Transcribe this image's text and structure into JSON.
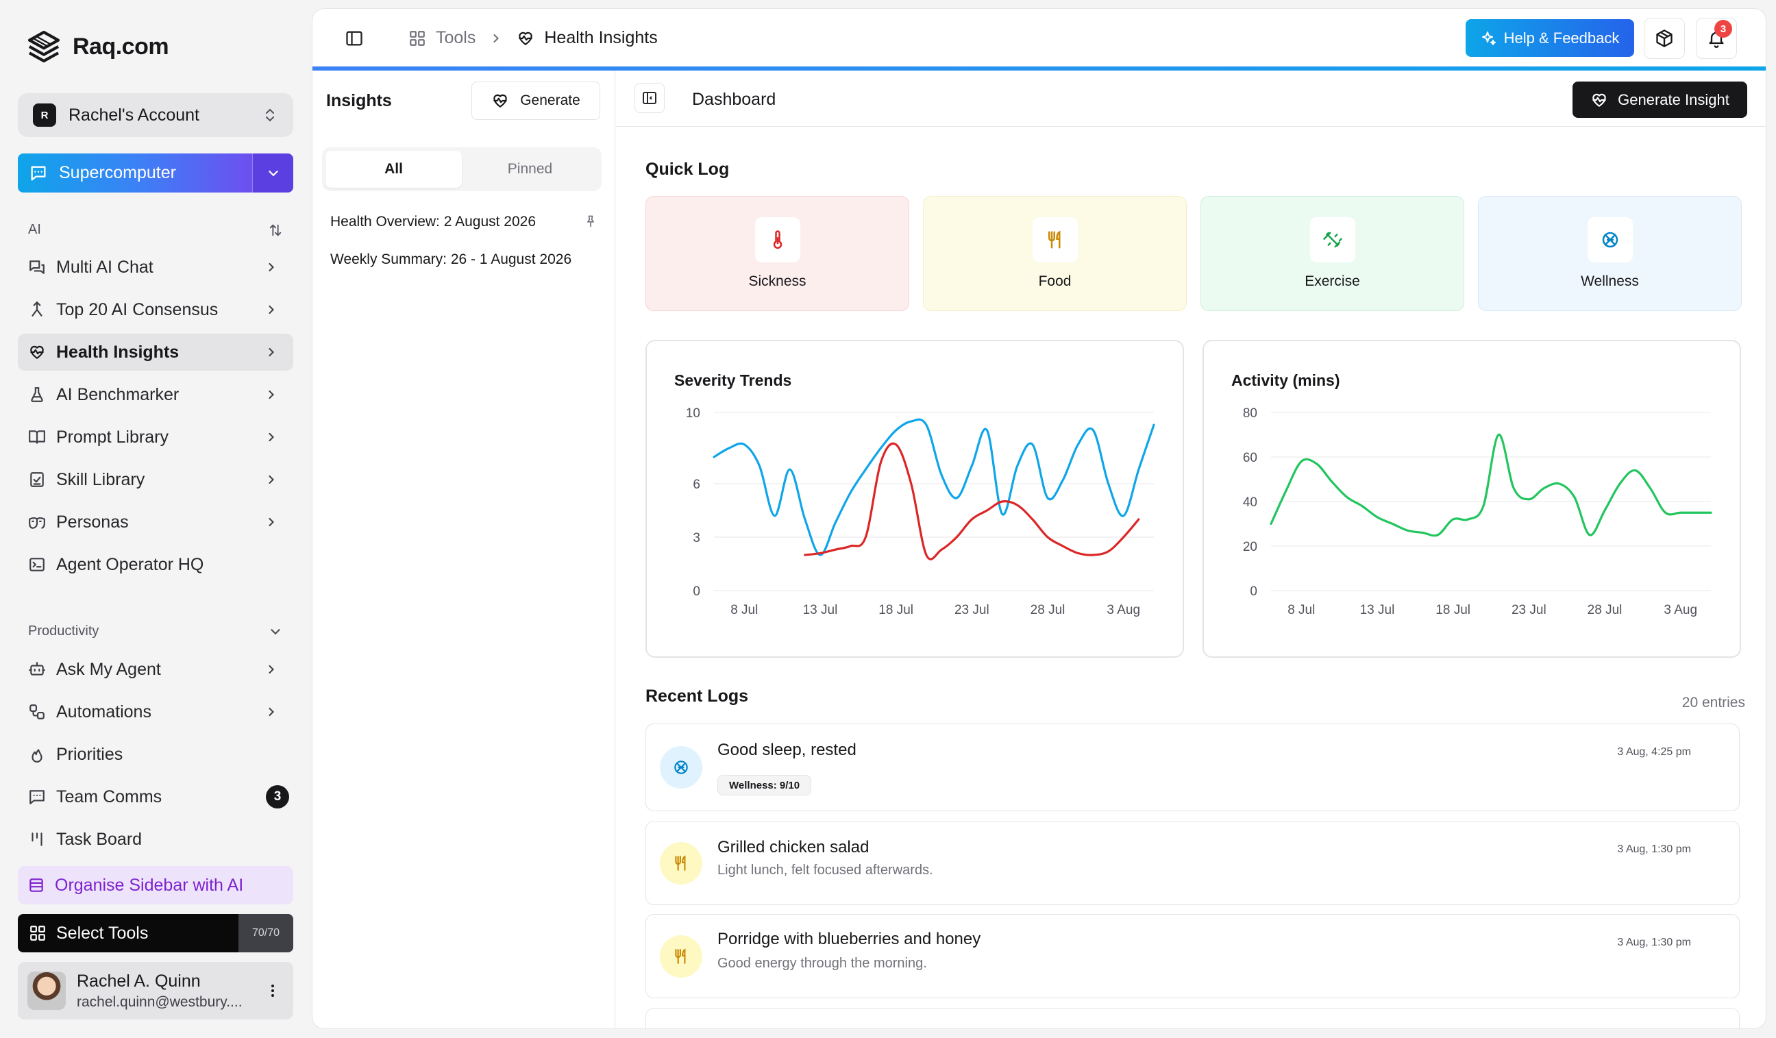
{
  "brand": {
    "name": "Raq.com"
  },
  "account": {
    "badge": "R",
    "name": "Rachel's Account"
  },
  "supercomputer": {
    "label": "Supercomputer"
  },
  "sections": {
    "ai": "AI",
    "productivity": "Productivity"
  },
  "nav_ai": [
    {
      "label": "Multi AI Chat",
      "icon": "chat-icon"
    },
    {
      "label": "Top 20 AI Consensus",
      "icon": "merge-icon"
    },
    {
      "label": "Health Insights",
      "icon": "heart-pulse-icon"
    },
    {
      "label": "AI Benchmarker",
      "icon": "flask-icon"
    },
    {
      "label": "Prompt Library",
      "icon": "book-icon"
    },
    {
      "label": "Skill Library",
      "icon": "clipboard-icon"
    },
    {
      "label": "Personas",
      "icon": "mask-icon"
    },
    {
      "label": "Agent Operator HQ",
      "icon": "terminal-icon"
    }
  ],
  "nav_productivity": [
    {
      "label": "Ask My Agent",
      "icon": "bot-icon"
    },
    {
      "label": "Automations",
      "icon": "workflow-icon"
    },
    {
      "label": "Priorities",
      "icon": "flame-icon"
    },
    {
      "label": "Team Comms",
      "icon": "message-icon",
      "badge": "3"
    },
    {
      "label": "Task Board",
      "icon": "kanban-icon"
    }
  ],
  "organise": {
    "label": "Organise Sidebar with AI"
  },
  "select_tools": {
    "label": "Select Tools",
    "count": "70/70"
  },
  "user": {
    "name": "Rachel A. Quinn",
    "email": "rachel.quinn@westbury...."
  },
  "breadcrumb": {
    "parent": "Tools",
    "current": "Health Insights"
  },
  "topbar": {
    "help_label": "Help & Feedback",
    "notification_count": "3"
  },
  "insights": {
    "title": "Insights",
    "generate_label": "Generate",
    "tabs": [
      "All",
      "Pinned"
    ],
    "items": [
      "Health Overview: 2 August 2026",
      "Weekly Summary: 26 - 1 August 2026"
    ]
  },
  "dashboard": {
    "title": "Dashboard",
    "generate_insight_label": "Generate Insight",
    "quick_log_title": "Quick Log",
    "quick_log": [
      {
        "label": "Sickness",
        "icon": "thermometer-icon",
        "bg": "#fdeeee",
        "border": "#f7d4d4",
        "color": "#dc2626"
      },
      {
        "label": "Food",
        "icon": "utensils-icon",
        "bg": "#fdfbe5",
        "border": "#f5efc4",
        "color": "#ca8a04"
      },
      {
        "label": "Exercise",
        "icon": "dumbbell-icon",
        "bg": "#ecfbf2",
        "border": "#cdeedb",
        "color": "#16a34a"
      },
      {
        "label": "Wellness",
        "icon": "brain-icon",
        "bg": "#eef7fe",
        "border": "#d6e9fa",
        "color": "#0284c7"
      }
    ],
    "recent_logs_title": "Recent Logs",
    "entries_label": "20 entries",
    "logs": [
      {
        "title": "Good sleep, rested",
        "badge": "Wellness: 9/10",
        "time": "3 Aug, 4:25 pm",
        "icon": "brain-icon"
      },
      {
        "title": "Grilled chicken salad",
        "sub": "Light lunch, felt focused afterwards.",
        "time": "3 Aug, 1:30 pm",
        "icon": "utensils-icon"
      },
      {
        "title": "Porridge with blueberries and honey",
        "sub": "Good energy through the morning.",
        "time": "3 Aug, 1:30 pm",
        "icon": "utensils-icon"
      }
    ]
  },
  "colors": {
    "sickness": "#dc2626",
    "wellness": "#0ea5e9",
    "exercise": "#22c55e",
    "accent": "#3b82f6"
  },
  "chart_data": [
    {
      "type": "line",
      "title": "Severity Trends",
      "xlabel": "",
      "ylabel": "",
      "x_ticks": [
        "8 Jul",
        "13 Jul",
        "18 Jul",
        "23 Jul",
        "28 Jul",
        "3 Aug"
      ],
      "y_ticks": [
        0,
        3,
        6,
        10
      ],
      "ylim": [
        0,
        10
      ],
      "x": [
        "6 Jul",
        "7 Jul",
        "8 Jul",
        "9 Jul",
        "10 Jul",
        "11 Jul",
        "12 Jul",
        "13 Jul",
        "14 Jul",
        "15 Jul",
        "16 Jul",
        "17 Jul",
        "18 Jul",
        "19 Jul",
        "20 Jul",
        "21 Jul",
        "22 Jul",
        "23 Jul",
        "24 Jul",
        "25 Jul",
        "26 Jul",
        "27 Jul",
        "28 Jul",
        "29 Jul",
        "30 Jul",
        "31 Jul",
        "1 Aug",
        "2 Aug",
        "3 Aug",
        "4 Aug"
      ],
      "series": [
        {
          "color": "#0ea5e9",
          "values": [
            7.5,
            8.0,
            8.2,
            7.0,
            4.2,
            6.8,
            4.0,
            2.0,
            3.8,
            5.5,
            6.8,
            8.0,
            9.0,
            9.5,
            9.3,
            6.5,
            5.2,
            7.0,
            9.0,
            4.3,
            7.0,
            8.2,
            5.2,
            6.2,
            8.2,
            9.0,
            6.0,
            4.2,
            6.8,
            9.3
          ]
        },
        {
          "color": "#dc2626",
          "values": [
            null,
            null,
            null,
            null,
            null,
            null,
            2.0,
            2.1,
            2.3,
            2.5,
            3.0,
            7.2,
            8.2,
            6.0,
            2.0,
            2.3,
            3.0,
            4.0,
            4.5,
            5.0,
            4.8,
            4.0,
            3.0,
            2.5,
            2.1,
            2.0,
            2.2,
            3.0,
            4.0,
            null
          ]
        }
      ]
    },
    {
      "type": "line",
      "title": "Activity (mins)",
      "xlabel": "",
      "ylabel": "",
      "x_ticks": [
        "8 Jul",
        "13 Jul",
        "18 Jul",
        "23 Jul",
        "28 Jul",
        "3 Aug"
      ],
      "y_ticks": [
        0,
        20,
        40,
        60,
        80
      ],
      "ylim": [
        0,
        80
      ],
      "x": [
        "6 Jul",
        "7 Jul",
        "8 Jul",
        "9 Jul",
        "10 Jul",
        "11 Jul",
        "12 Jul",
        "13 Jul",
        "14 Jul",
        "15 Jul",
        "16 Jul",
        "17 Jul",
        "18 Jul",
        "19 Jul",
        "20 Jul",
        "21 Jul",
        "22 Jul",
        "23 Jul",
        "24 Jul",
        "25 Jul",
        "26 Jul",
        "27 Jul",
        "28 Jul",
        "29 Jul",
        "30 Jul",
        "31 Jul",
        "1 Aug",
        "2 Aug",
        "3 Aug",
        "4 Aug"
      ],
      "series": [
        {
          "color": "#22c55e",
          "values": [
            30,
            45,
            58,
            57,
            49,
            42,
            38,
            33,
            30,
            27,
            26,
            25,
            32,
            32,
            38,
            70,
            46,
            41,
            46,
            48,
            42,
            25,
            36,
            48,
            54,
            46,
            35,
            35,
            35,
            35
          ]
        }
      ]
    }
  ]
}
